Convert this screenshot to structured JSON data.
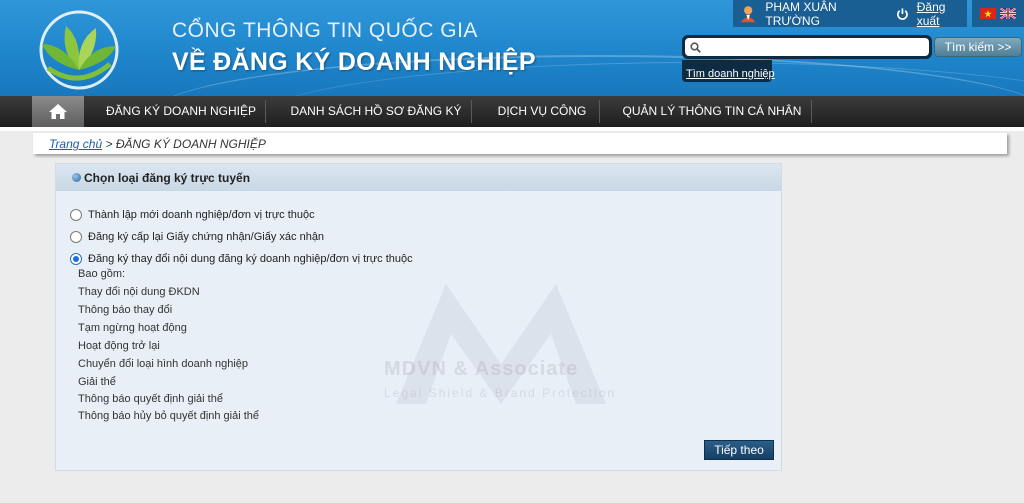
{
  "header": {
    "title_top": "CỔNG THÔNG TIN QUỐC GIA",
    "title_main": "VỀ ĐĂNG KÝ DOANH NGHIỆP",
    "user_name": "PHẠM XUÂN TRƯỜNG",
    "logout_label": "Đăng xuất",
    "search_placeholder": "",
    "search_button": "Tìm kiếm >>",
    "search_link": "Tìm doanh nghiệp",
    "icons": [
      "logo-icon",
      "user-icon",
      "power-icon",
      "vn-flag-icon",
      "uk-flag-icon",
      "search-icon"
    ]
  },
  "nav": {
    "home_icon": "home-icon",
    "items": [
      {
        "label": "ĐĂNG KÝ DOANH NGHIỆP"
      },
      {
        "label": "DANH SÁCH HỒ SƠ ĐĂNG KÝ"
      },
      {
        "label": "DỊCH VỤ CÔNG"
      },
      {
        "label": "QUẢN LÝ THÔNG TIN CÁ NHÂN"
      }
    ]
  },
  "breadcrumb": {
    "home": "Trang chủ",
    "separator": " > ",
    "current": "ĐĂNG KÝ DOANH NGHIỆP"
  },
  "panel": {
    "title": "Chọn loại đăng ký trực tuyến",
    "options": [
      {
        "label": "Thành lập mới doanh nghiệp/đơn vị trực thuộc",
        "checked": false
      },
      {
        "label": "Đăng ký cấp lại Giấy chứng nhận/Giấy xác nhận",
        "checked": false
      },
      {
        "label": "Đăng ký thay đổi nội dung đăng ký doanh nghiệp/đơn vị trực thuộc",
        "checked": true
      }
    ],
    "includes_label": "Bao gồm:",
    "includes": [
      "Thay đổi nội dung ĐKDN",
      "Thông báo thay đổi",
      "Tạm ngừng hoạt động",
      "Hoạt động trở lại",
      "Chuyển đổi loại hình doanh nghiệp",
      "Giải thể",
      "Thông báo quyết định giải thể",
      "Thông báo hủy bỏ quyết định giải thể"
    ],
    "next_button": "Tiếp theo"
  },
  "watermark": {
    "title": "MDVN & Associate",
    "subtitle": "Legal Shield & Brand Protection"
  },
  "colors": {
    "header_blue": "#1f86cc",
    "nav_dark": "#1e1e1e",
    "panel_bg": "#e8eff6",
    "button_blue": "#163f63",
    "link_blue": "#1a5ea8"
  }
}
